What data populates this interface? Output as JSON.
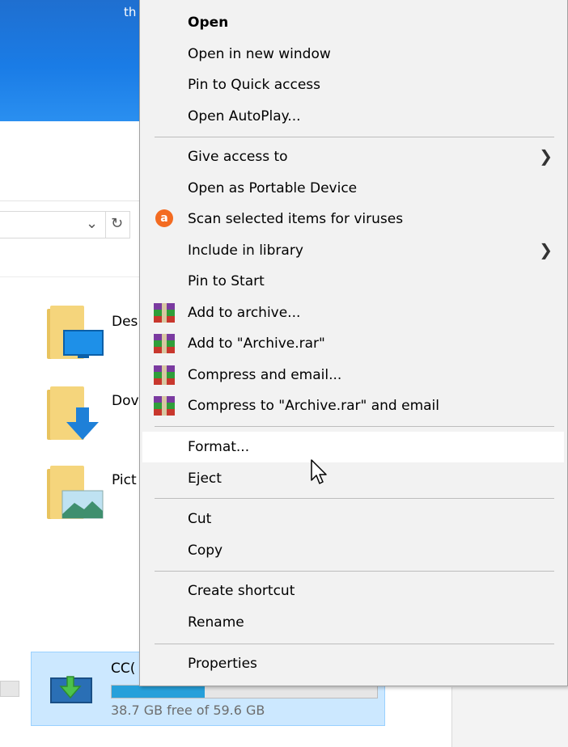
{
  "window": {
    "title_fragment": "th"
  },
  "explorer": {
    "folders": [
      {
        "label": "Des",
        "icon": "desktop-folder-icon"
      },
      {
        "label": "Dov",
        "icon": "downloads-folder-icon"
      },
      {
        "label": "Pict",
        "icon": "pictures-folder-icon"
      }
    ],
    "drive": {
      "name": "CC(",
      "free_text": "38.7 GB free of 59.6 GB",
      "used_fraction": 0.35,
      "icon": "usb-drive-icon"
    }
  },
  "context_menu": {
    "items": [
      {
        "label": "Open",
        "bold": true
      },
      {
        "label": "Open in new window"
      },
      {
        "label": "Pin to Quick access"
      },
      {
        "label": "Open AutoPlay..."
      },
      {
        "label": "Give access to",
        "submenu": true
      },
      {
        "label": "Open as Portable Device"
      },
      {
        "label": "Scan selected items for viruses",
        "icon": "avast-icon"
      },
      {
        "label": "Include in library",
        "submenu": true
      },
      {
        "label": "Pin to Start"
      },
      {
        "label": "Add to archive...",
        "icon": "winrar-icon"
      },
      {
        "label": "Add to \"Archive.rar\"",
        "icon": "winrar-icon"
      },
      {
        "label": "Compress and email...",
        "icon": "winrar-icon"
      },
      {
        "label": "Compress to \"Archive.rar\" and email",
        "icon": "winrar-icon"
      },
      {
        "label": "Format...",
        "highlighted": true
      },
      {
        "label": "Eject"
      },
      {
        "label": "Cut"
      },
      {
        "label": "Copy"
      },
      {
        "label": "Create shortcut"
      },
      {
        "label": "Rename"
      },
      {
        "label": "Properties"
      }
    ]
  },
  "colors": {
    "menu_bg": "#f2f2f2",
    "hover_bg": "#ffffff",
    "drive_selected_bg": "#cce8ff",
    "drive_bar_fill": "#26a0da",
    "avast_orange": "#f36b21"
  }
}
